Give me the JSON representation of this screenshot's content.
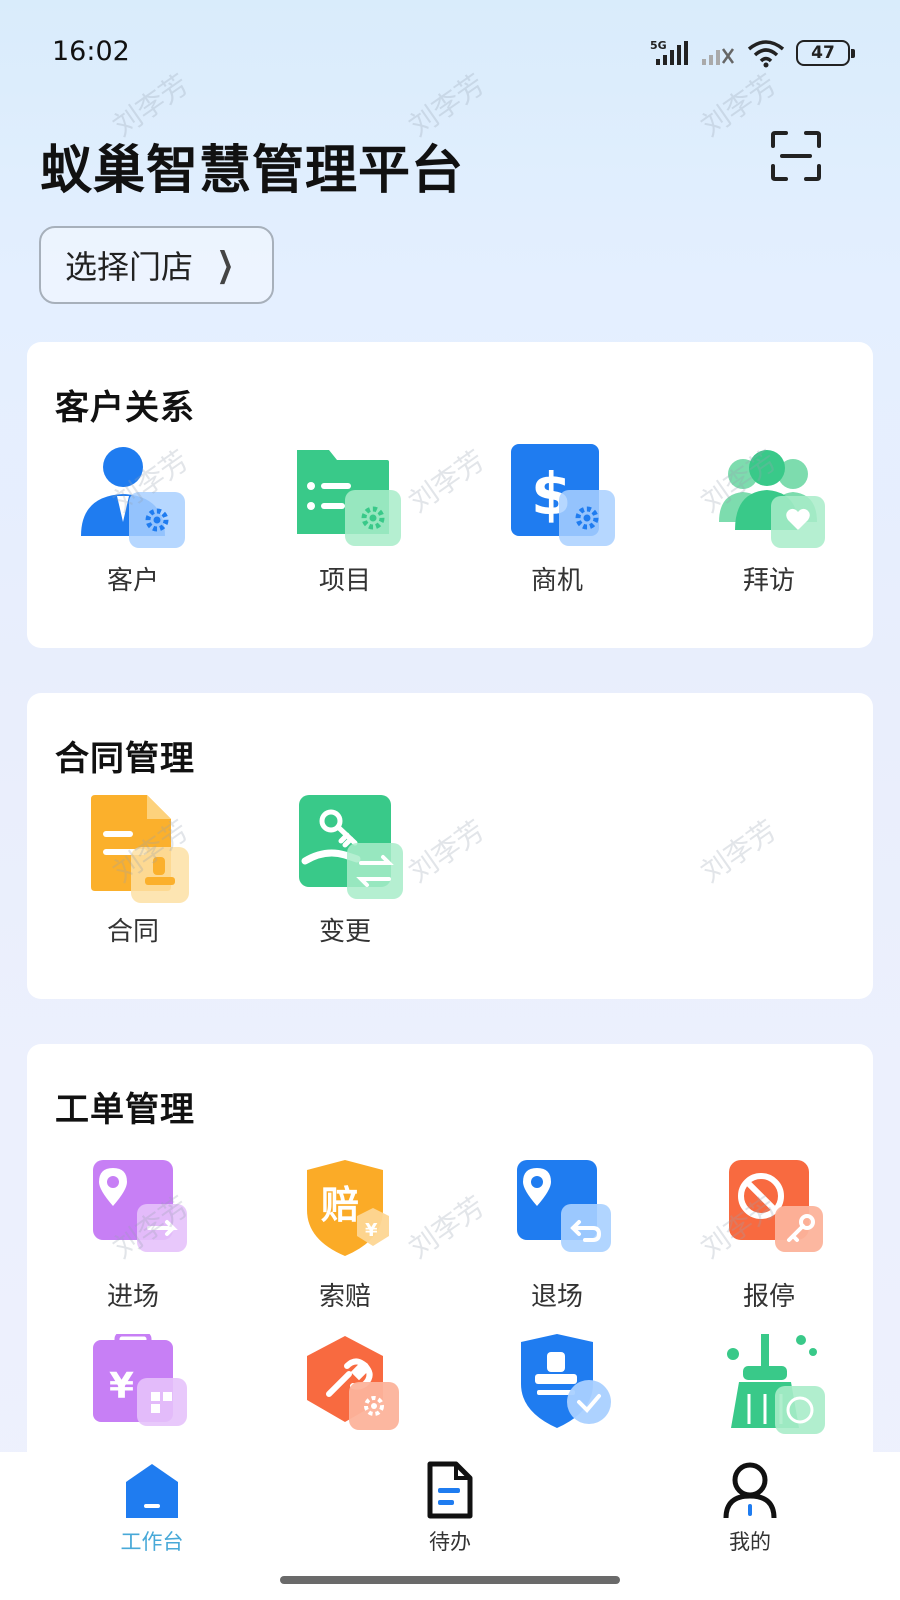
{
  "status_bar": {
    "time": "16:02",
    "network": "5G",
    "battery": "47"
  },
  "header": {
    "title": "蚁巢智慧管理平台",
    "scan_icon": "scan-icon",
    "store_selector": "选择门店"
  },
  "sections": [
    {
      "title": "客户关系",
      "items": [
        {
          "label": "客户",
          "icon": "customer-icon",
          "color": "#1f7cf0"
        },
        {
          "label": "项目",
          "icon": "project-folder-icon",
          "color": "#39c989"
        },
        {
          "label": "商机",
          "icon": "opportunity-dollar-icon",
          "color": "#1f7cf0"
        },
        {
          "label": "拜访",
          "icon": "visit-people-icon",
          "color": "#39c989"
        }
      ]
    },
    {
      "title": "合同管理",
      "items": [
        {
          "label": "合同",
          "icon": "contract-icon",
          "color": "#fbb02c"
        },
        {
          "label": "变更",
          "icon": "change-key-icon",
          "color": "#39c989"
        }
      ]
    },
    {
      "title": "工单管理",
      "items": [
        {
          "label": "进场",
          "icon": "enter-site-icon",
          "color": "#c77ff5"
        },
        {
          "label": "索赔",
          "icon": "claim-shield-icon",
          "color": "#fbab27"
        },
        {
          "label": "退场",
          "icon": "exit-site-icon",
          "color": "#1f7cf0"
        },
        {
          "label": "报停",
          "icon": "report-stop-icon",
          "color": "#f86a40"
        },
        {
          "label": "",
          "icon": "fee-clipboard-icon",
          "color": "#c77ff5"
        },
        {
          "label": "",
          "icon": "repair-wrench-icon",
          "color": "#f86a40"
        },
        {
          "label": "",
          "icon": "seal-shield-icon",
          "color": "#1f7cf0"
        },
        {
          "label": "",
          "icon": "cleaning-broom-icon",
          "color": "#39c989"
        }
      ]
    }
  ],
  "bottom_nav": [
    {
      "label": "工作台",
      "icon": "workbench-home-icon",
      "active": true
    },
    {
      "label": "待办",
      "icon": "todo-document-icon",
      "active": false
    },
    {
      "label": "我的",
      "icon": "profile-person-icon",
      "active": false
    }
  ],
  "watermark_text": "刘李芳",
  "colors": {
    "accent": "#48a9d8",
    "blue": "#1f7cf0",
    "green": "#39c989",
    "orange": "#fbb02c",
    "purple": "#c77ff5",
    "red": "#f86a40"
  }
}
